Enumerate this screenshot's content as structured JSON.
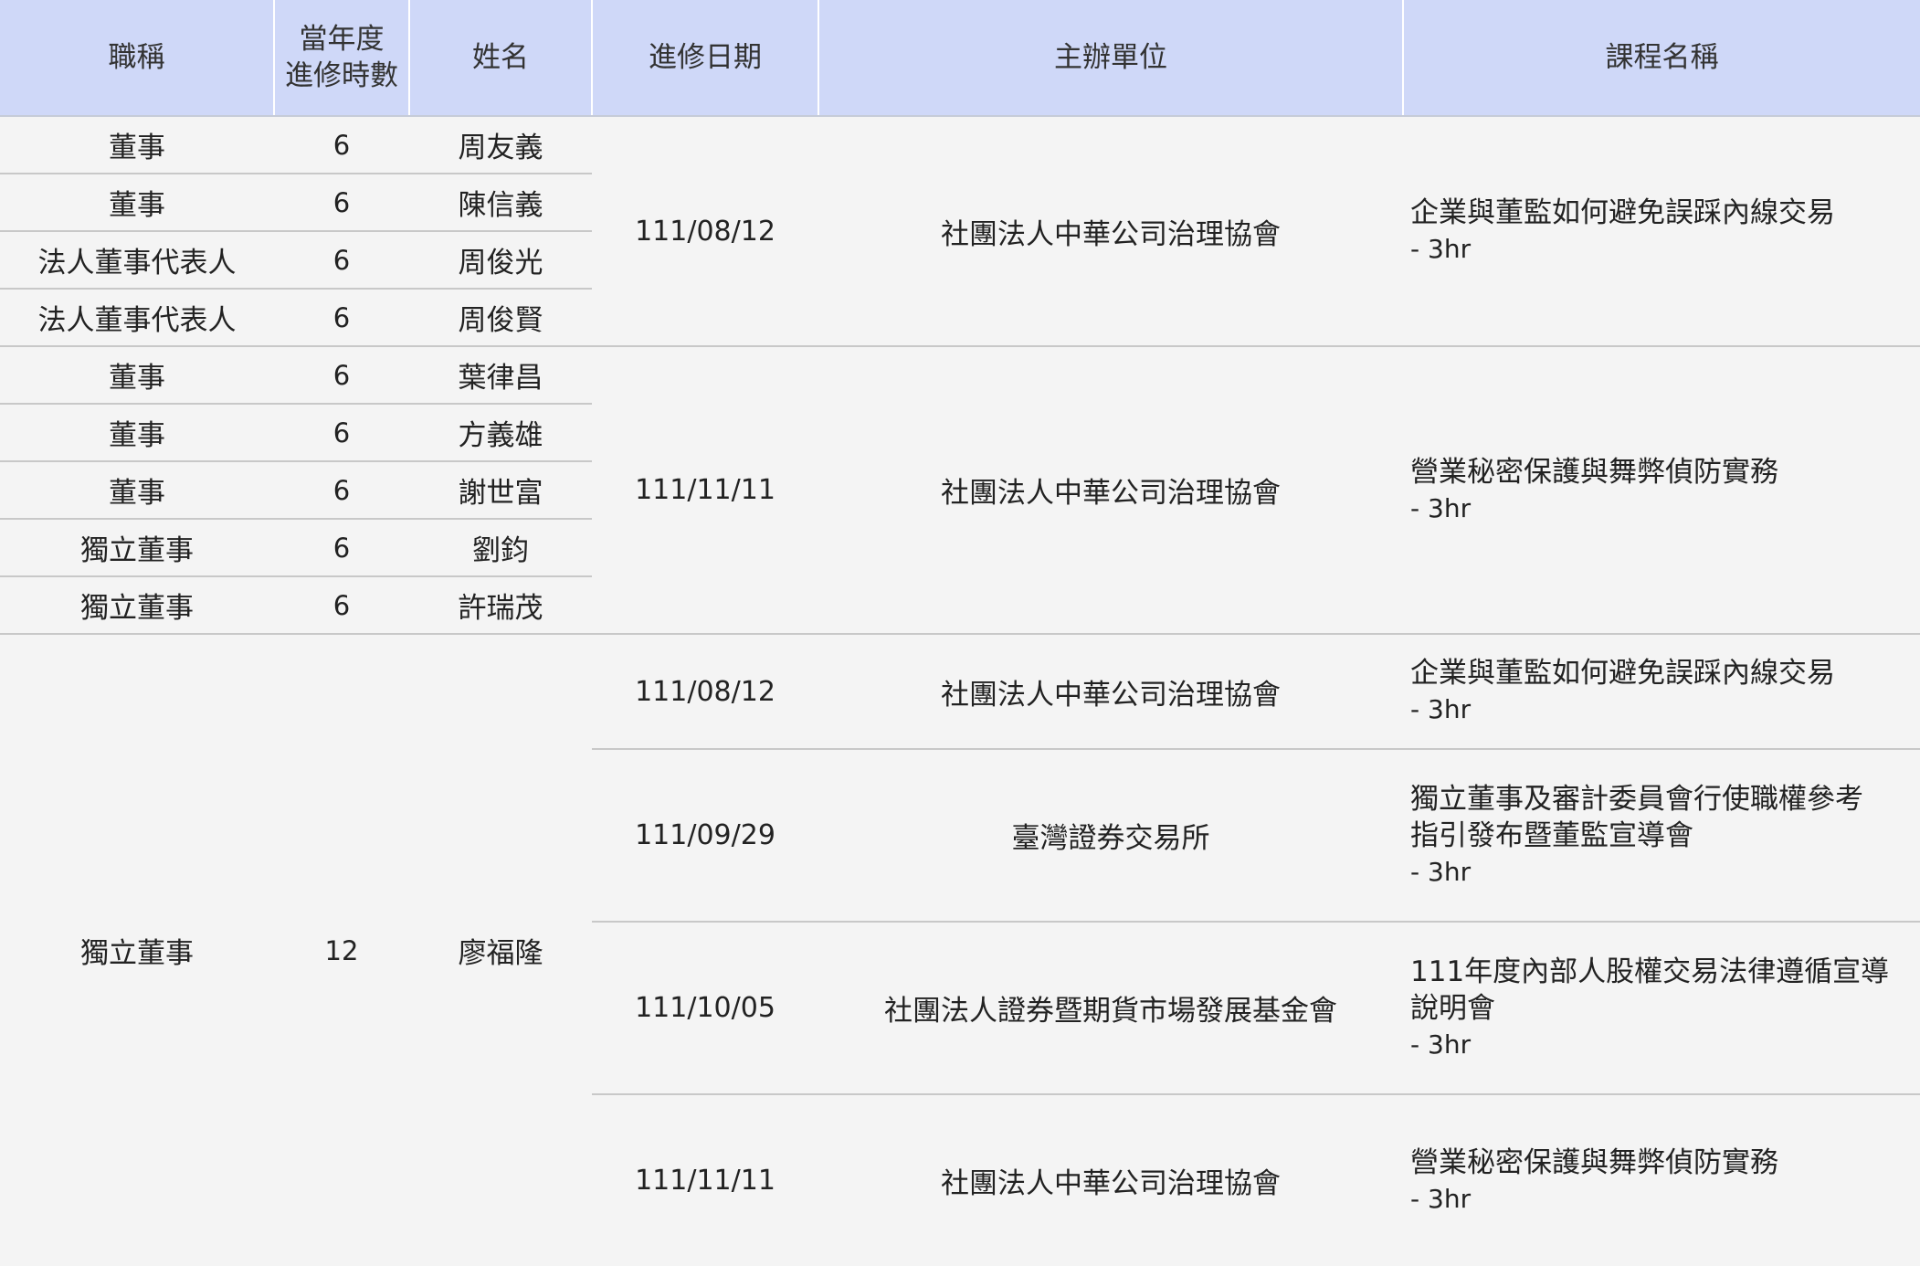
{
  "headers": {
    "title": "職稱",
    "hours_line1": "當年度",
    "hours_line2": "進修時數",
    "name": "姓名",
    "date": "進修日期",
    "organizer": "主辦單位",
    "course": "課程名稱"
  },
  "group1": {
    "date": "111/08/12",
    "organizer": "社團法人中華公司治理協會",
    "course_title": "企業與董監如何避免誤踩內線交易",
    "course_hours": "- 3hr",
    "people": [
      {
        "title": "董事",
        "hours": "6",
        "name": "周友義"
      },
      {
        "title": "董事",
        "hours": "6",
        "name": "陳信義"
      },
      {
        "title": "法人董事代表人",
        "hours": "6",
        "name": "周俊光"
      },
      {
        "title": "法人董事代表人",
        "hours": "6",
        "name": "周俊賢"
      }
    ]
  },
  "group2": {
    "date": "111/11/11",
    "organizer": "社團法人中華公司治理協會",
    "course_title": "營業秘密保護與舞弊偵防實務",
    "course_hours": "- 3hr",
    "people": [
      {
        "title": "董事",
        "hours": "6",
        "name": "葉律昌"
      },
      {
        "title": "董事",
        "hours": "6",
        "name": "方義雄"
      },
      {
        "title": "董事",
        "hours": "6",
        "name": "謝世富"
      },
      {
        "title": "獨立董事",
        "hours": "6",
        "name": "劉鈞"
      },
      {
        "title": "獨立董事",
        "hours": "6",
        "name": "許瑞茂"
      }
    ]
  },
  "group3": {
    "title": "獨立董事",
    "hours": "12",
    "name": "廖福隆",
    "courses": [
      {
        "date": "111/08/12",
        "organizer": "社團法人中華公司治理協會",
        "line1": "企業與董監如何避免誤踩內線交易",
        "line2": "",
        "hours": "- 3hr"
      },
      {
        "date": "111/09/29",
        "organizer": "臺灣證券交易所",
        "line1": "獨立董事及審計委員會行使職權參考",
        "line2": "指引發布暨董監宣導會",
        "hours": "- 3hr"
      },
      {
        "date": "111/10/05",
        "organizer": "社團法人證券暨期貨市場發展基金會",
        "line1": "111年度內部人股權交易法律遵循宣導",
        "line2": "說明會",
        "hours": "- 3hr"
      },
      {
        "date": "111/11/11",
        "organizer": "社團法人中華公司治理協會",
        "line1": "營業秘密保護與舞弊偵防實務",
        "line2": "",
        "hours": "- 3hr"
      }
    ]
  }
}
